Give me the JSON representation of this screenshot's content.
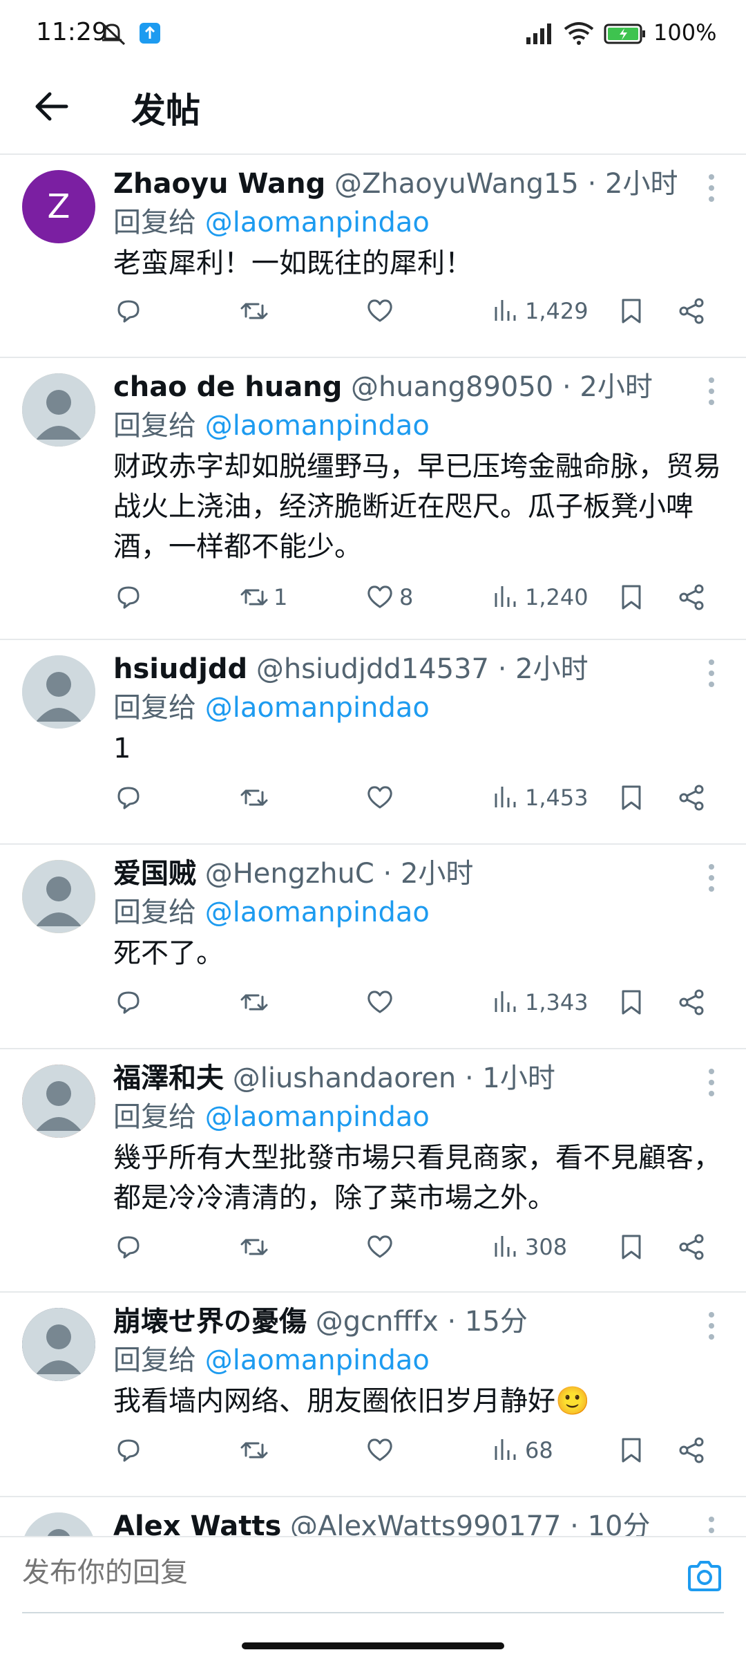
{
  "status_bar": {
    "time": "11:29",
    "battery": "100%"
  },
  "header": {
    "title": "发帖"
  },
  "reply_prefix": "回复给",
  "tweets": [
    {
      "name": "Zhaoyu Wang",
      "handle": "@ZhaoyuWang15",
      "time": "2小时",
      "reply_to": "@laomanpindao",
      "text": "老蛮犀利！一如既往的犀利！",
      "avatar_letter": "Z",
      "avatar_color": "#7b1fa2",
      "retweets": "",
      "likes": "",
      "views": "1,429"
    },
    {
      "name": "chao de huang",
      "handle": "@huang89050",
      "time": "2小时",
      "reply_to": "@laomanpindao",
      "text": "财政赤字却如脱缰野马，早已压垮金融命脉，贸易战火上浇油，经济脆断近在咫尺。瓜子板凳小啤酒，一样都不能少。",
      "avatar_letter": "",
      "avatar_color": "#b8a898",
      "retweets": "1",
      "likes": "8",
      "views": "1,240"
    },
    {
      "name": "hsiudjdd",
      "handle": "@hsiudjdd14537",
      "time": "2小时",
      "reply_to": "@laomanpindao",
      "text": "1",
      "avatar_letter": "",
      "avatar_color": "#cfd9de",
      "retweets": "",
      "likes": "",
      "views": "1,453"
    },
    {
      "name": "爱国贼",
      "handle": "@HengzhuC",
      "time": "2小时",
      "reply_to": "@laomanpindao",
      "text": "死不了。",
      "avatar_letter": "",
      "avatar_color": "#f6c77a",
      "retweets": "",
      "likes": "",
      "views": "1,343"
    },
    {
      "name": "福澤和夫",
      "handle": "@liushandaoren",
      "time": "1小时",
      "reply_to": "@laomanpindao",
      "text": "幾乎所有大型批發市場只看見商家，看不見顧客，都是冷冷清清的，除了菜市場之外。",
      "avatar_letter": "",
      "avatar_color": "#c0532a",
      "retweets": "",
      "likes": "",
      "views": "308"
    },
    {
      "name": "崩壊せ界の憂傷",
      "handle": "@gcnfffx",
      "time": "15分",
      "reply_to": "@laomanpindao",
      "text": "我看墙内网络、朋友圈依旧岁月静好🙂",
      "avatar_letter": "",
      "avatar_color": "#3a3f5a",
      "retweets": "",
      "likes": "",
      "views": "68"
    },
    {
      "name": "Alex Watts",
      "handle": "@AlexWatts990177",
      "time": "10分",
      "reply_to": "",
      "text": "",
      "avatar_letter": "",
      "avatar_color": "#cfd9de",
      "retweets": "",
      "likes": "",
      "views": ""
    }
  ],
  "composer": {
    "placeholder": "发布你的回复"
  },
  "colors": {
    "accent": "#1d9bf0",
    "secondary_text": "#536471",
    "divider": "#e6e9eb"
  }
}
